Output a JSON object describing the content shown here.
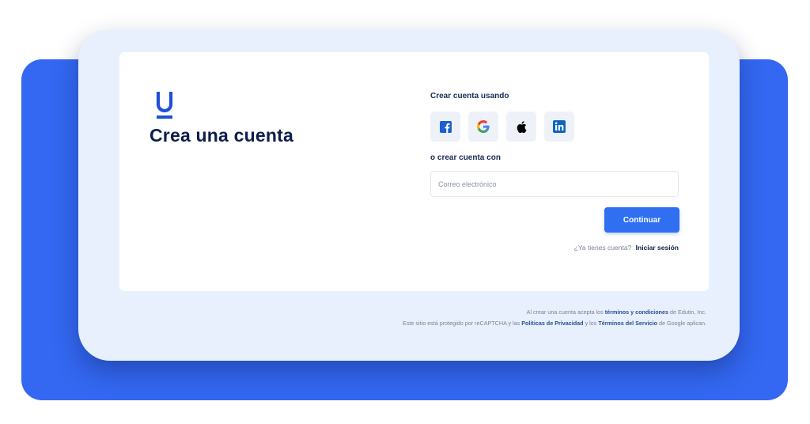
{
  "page": {
    "title": "Crea una cuenta",
    "logo_icon": "edutin-u-logo"
  },
  "signup": {
    "social_label": "Crear cuenta usando",
    "social_providers": [
      {
        "name": "Facebook",
        "icon": "facebook-icon",
        "color": "#1a5ecf"
      },
      {
        "name": "Google",
        "icon": "google-icon",
        "color": "#4285F4"
      },
      {
        "name": "Apple",
        "icon": "apple-icon",
        "color": "#000000"
      },
      {
        "name": "LinkedIn",
        "icon": "linkedin-icon",
        "color": "#0a66c2"
      }
    ],
    "email_label": "o crear cuenta con",
    "email_placeholder": "Correo electrónico",
    "email_value": "",
    "continue_label": "Continuar",
    "has_account_text": "¿Ya tienes cuenta?",
    "login_link": "Iniciar sesión"
  },
  "legal": {
    "terms_prefix": "Al crear una cuenta acepta los",
    "terms_link": "términos y condiciones",
    "terms_suffix": "de Edutin, Inc.",
    "recaptcha_prefix": "Este sitio está protegido por reCAPTCHA y las",
    "privacy_link": "Políticas de Privacidad",
    "recaptcha_mid": "y los",
    "service_link": "Términos del Servicio",
    "recaptcha_suffix": "de Google aplican."
  },
  "colors": {
    "accent": "#2f6ff0",
    "backdrop": "#3468f2",
    "frame": "#e9f0fd",
    "heading": "#0d1d4c"
  }
}
